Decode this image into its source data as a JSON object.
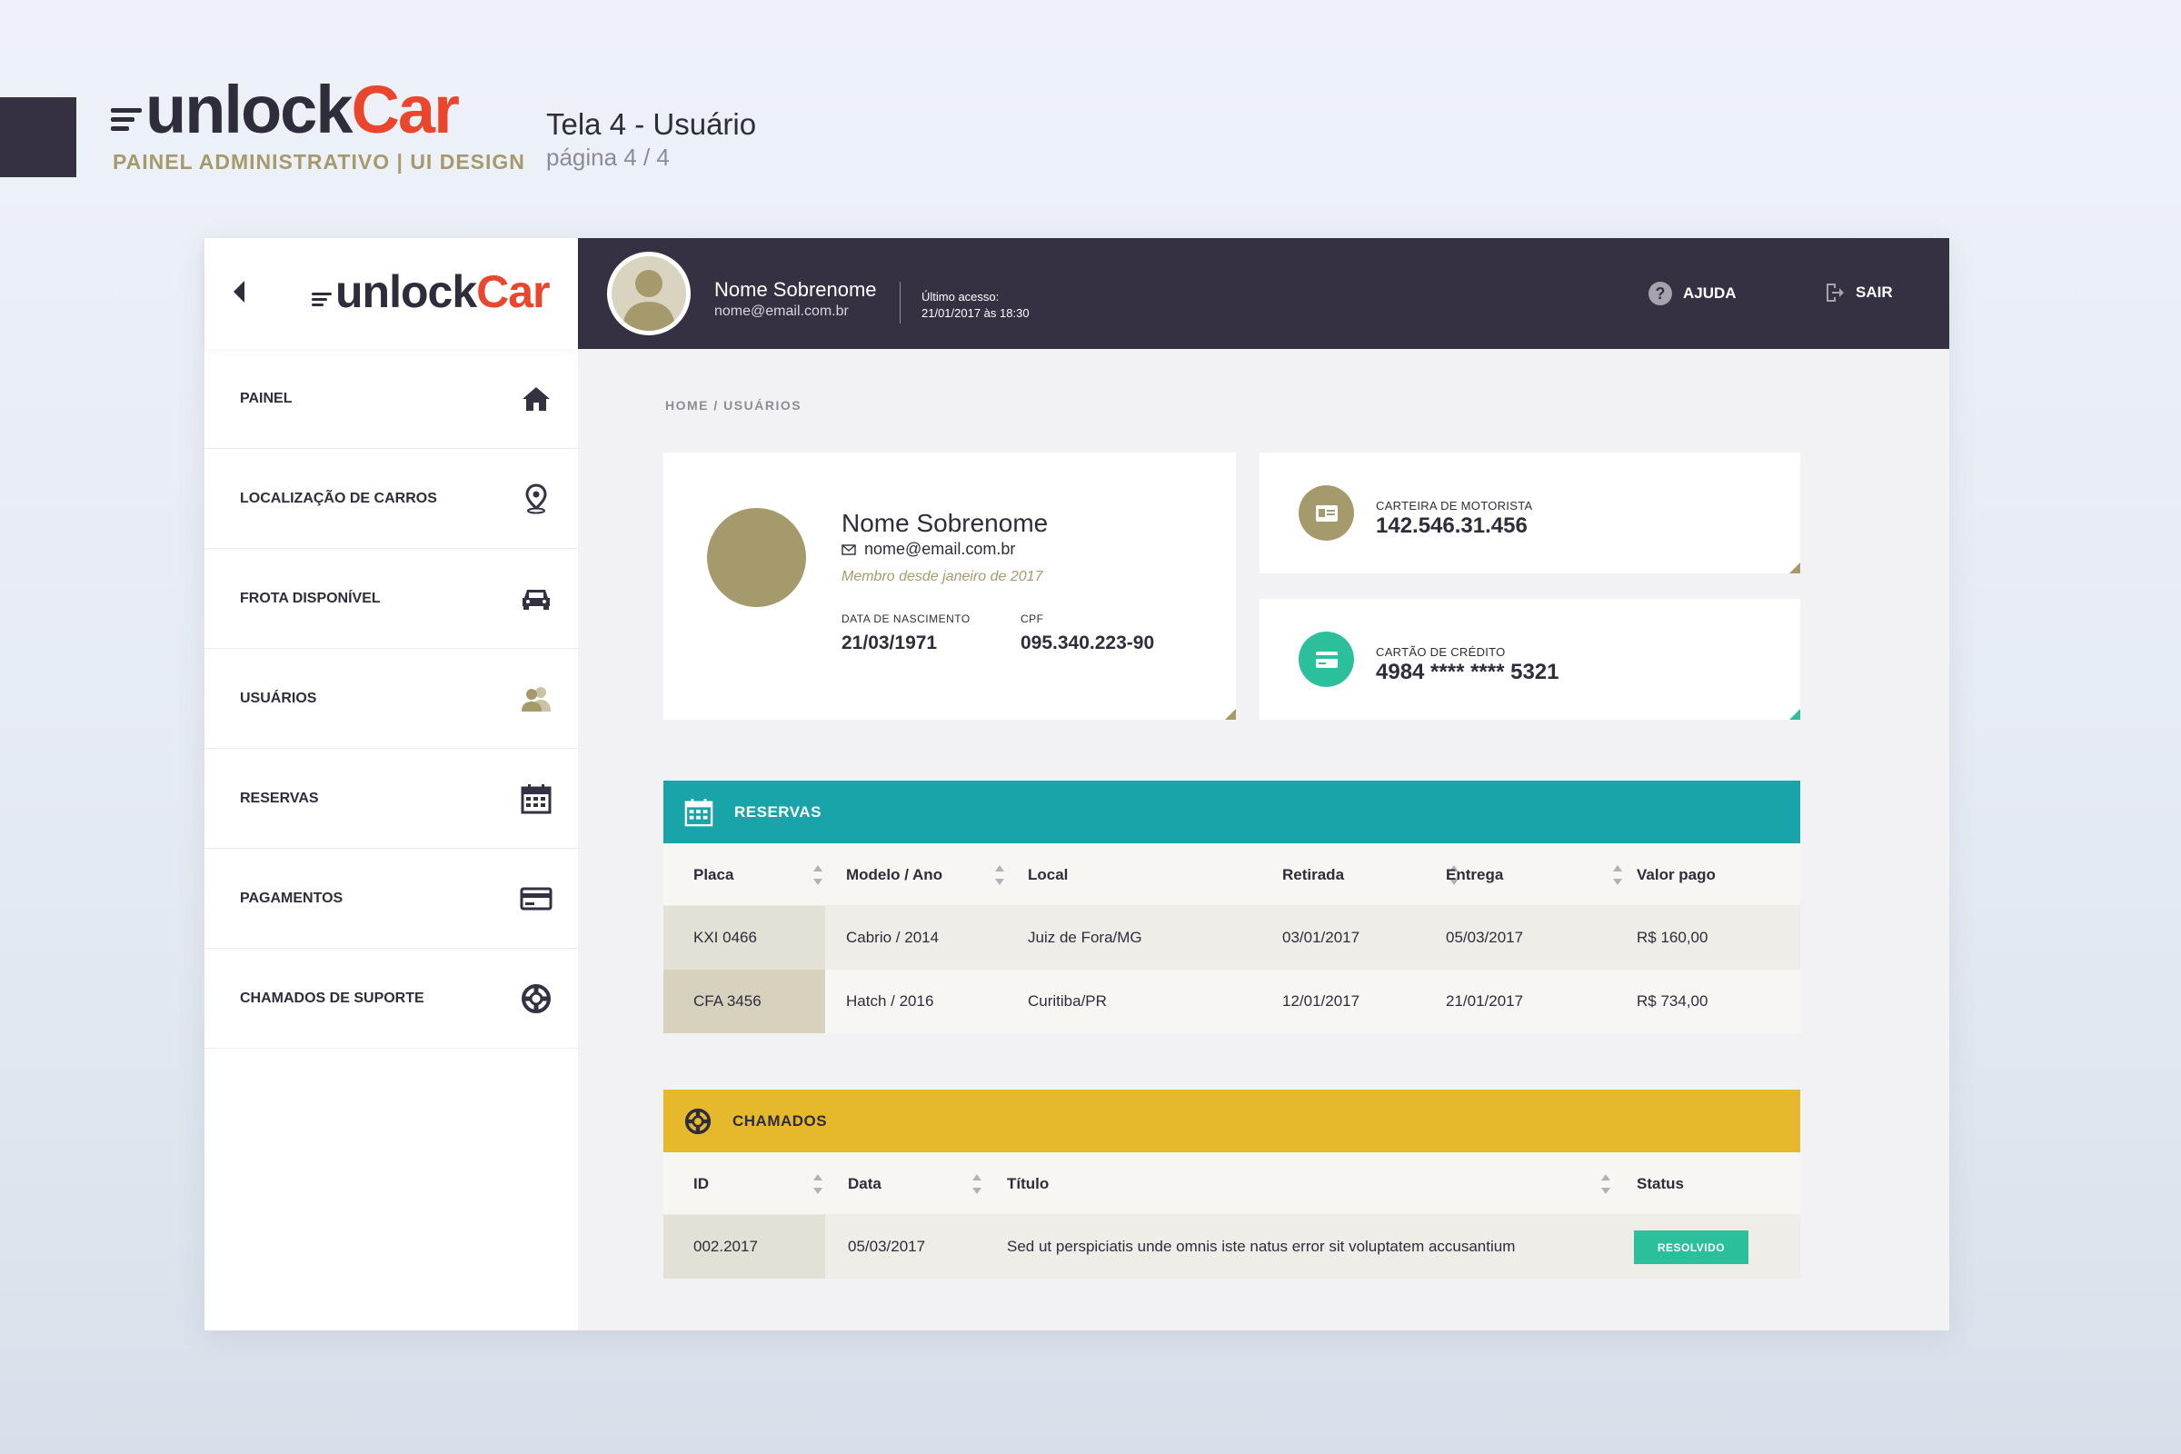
{
  "presentation": {
    "brand_unlock": "unlock",
    "brand_car": "Car",
    "subtitle": "PAINEL ADMINISTRATIVO | UI DESIGN",
    "screen_title": "Tela 4 - Usuário",
    "screen_page": "página 4 / 4"
  },
  "sidebar": {
    "logo_unlock": "unlock",
    "logo_car": "Car",
    "items": [
      {
        "label": "PAINEL",
        "icon": "home-icon"
      },
      {
        "label": "LOCALIZAÇÃO DE CARROS",
        "icon": "map-pin-icon"
      },
      {
        "label": "FROTA DISPONÍVEL",
        "icon": "car-icon"
      },
      {
        "label": "USUÁRIOS",
        "icon": "users-icon"
      },
      {
        "label": "RESERVAS",
        "icon": "calendar-icon"
      },
      {
        "label": "PAGAMENTOS",
        "icon": "credit-card-icon"
      },
      {
        "label": "CHAMADOS DE SUPORTE",
        "icon": "lifebuoy-icon"
      }
    ]
  },
  "topbar": {
    "user_name": "Nome Sobrenome",
    "user_email": "nome@email.com.br",
    "last_access_label": "Último acesso:",
    "last_access_date": "21/01/2017 às 18:30",
    "help_label": "AJUDA",
    "exit_label": "SAIR"
  },
  "breadcrumb": "HOME / USUÁRIOS",
  "profile": {
    "name": "Nome Sobrenome",
    "email": "nome@email.com.br",
    "member_since": "Membro desde janeiro de 2017",
    "birth_label": "DATA DE NASCIMENTO",
    "birth_value": "21/03/1971",
    "cpf_label": "CPF",
    "cpf_value": "095.340.223-90"
  },
  "license": {
    "label": "CARTEIRA DE MOTORISTA",
    "value": "142.546.31.456"
  },
  "credit_card": {
    "label": "CARTÃO DE CRÉDITO",
    "value": "4984 **** **** 5321"
  },
  "reservations": {
    "title": "RESERVAS",
    "columns": [
      "Placa",
      "Modelo / Ano",
      "Local",
      "Retirada",
      "Entrega",
      "Valor pago"
    ],
    "rows": [
      [
        "KXI 0466",
        "Cabrio / 2014",
        "Juiz de Fora/MG",
        "03/01/2017",
        "05/03/2017",
        "R$ 160,00"
      ],
      [
        "CFA 3456",
        "Hatch / 2016",
        "Curitiba/PR",
        "12/01/2017",
        "21/01/2017",
        "R$ 734,00"
      ]
    ]
  },
  "tickets": {
    "title": "CHAMADOS",
    "columns": [
      "ID",
      "Data",
      "Título",
      "Status"
    ],
    "rows": [
      {
        "id": "002.2017",
        "date": "05/03/2017",
        "title": "Sed ut perspiciatis unde omnis iste natus error sit voluptatem accusantium",
        "status": "RESOLVIDO"
      }
    ]
  },
  "colors": {
    "dark": "#353042",
    "accent_red": "#e9462d",
    "gold": "#a59a6c",
    "teal": "#18a4a9",
    "yellow": "#e6b92d",
    "green": "#2bbf9b"
  }
}
